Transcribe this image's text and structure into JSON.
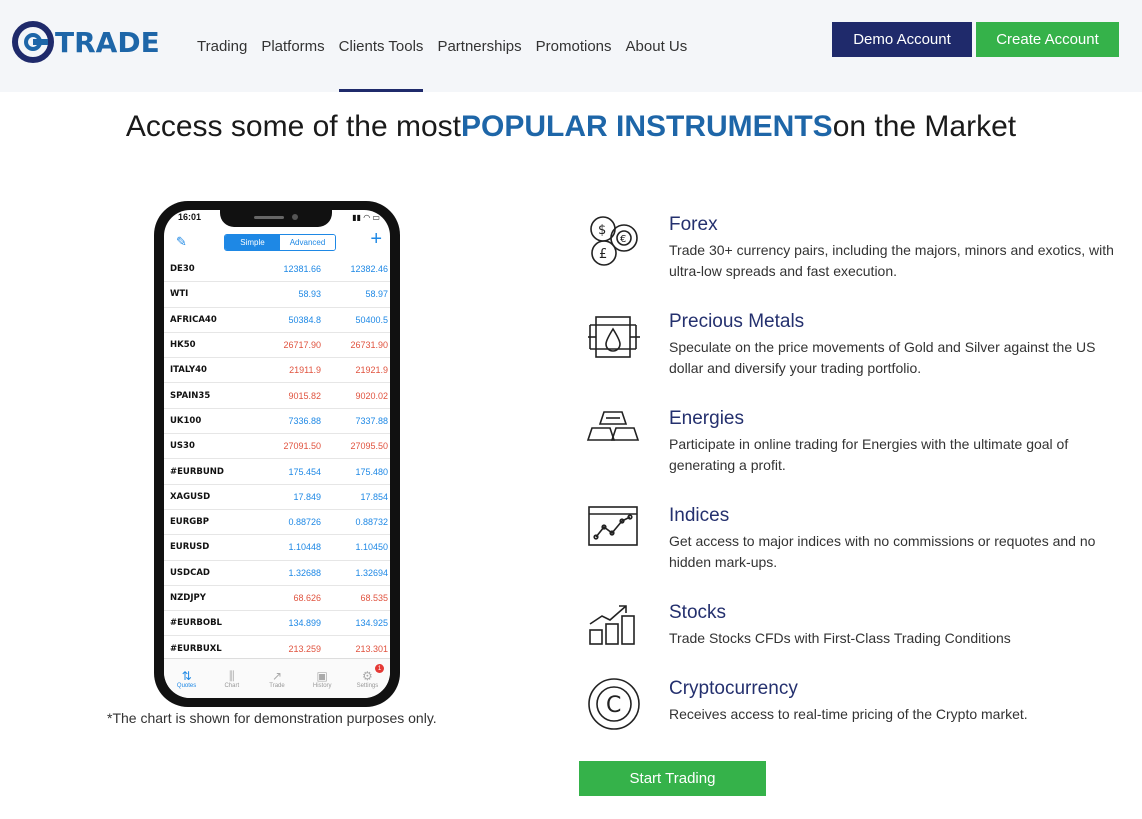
{
  "brand": {
    "name": "TRADE",
    "color": "#1e66a8"
  },
  "nav": {
    "items": [
      {
        "label": "Trading"
      },
      {
        "label": "Platforms"
      },
      {
        "label": "Clients Tools"
      },
      {
        "label": "Partnerships"
      },
      {
        "label": "Promotions"
      },
      {
        "label": "About Us"
      }
    ],
    "active": "Clients Tools"
  },
  "header_buttons": {
    "demo": "Demo Account",
    "create": "Create Account"
  },
  "headline": {
    "before": "Access some of the most",
    "highlight": "POPULAR INSTRUMENTS",
    "after": "on the Market"
  },
  "phone": {
    "time": "16:01",
    "segment": {
      "simple": "Simple",
      "advanced": "Advanced"
    },
    "quotes": [
      {
        "symbol": "DE30",
        "bid": "12381.66",
        "ask": "12382.46",
        "color": "blue"
      },
      {
        "symbol": "WTI",
        "bid": "58.93",
        "ask": "58.97",
        "color": "blue"
      },
      {
        "symbol": "AFRICA40",
        "bid": "50384.8",
        "ask": "50400.5",
        "color": "blue"
      },
      {
        "symbol": "HK50",
        "bid": "26717.90",
        "ask": "26731.90",
        "color": "red"
      },
      {
        "symbol": "ITALY40",
        "bid": "21911.9",
        "ask": "21921.9",
        "color": "red"
      },
      {
        "symbol": "SPAIN35",
        "bid": "9015.82",
        "ask": "9020.02",
        "color": "red"
      },
      {
        "symbol": "UK100",
        "bid": "7336.88",
        "ask": "7337.88",
        "color": "blue"
      },
      {
        "symbol": "US30",
        "bid": "27091.50",
        "ask": "27095.50",
        "color": "red"
      },
      {
        "symbol": "#EURBUND",
        "bid": "175.454",
        "ask": "175.480",
        "color": "blue"
      },
      {
        "symbol": "XAGUSD",
        "bid": "17.849",
        "ask": "17.854",
        "color": "blue"
      },
      {
        "symbol": "EURGBP",
        "bid": "0.88726",
        "ask": "0.88732",
        "color": "blue"
      },
      {
        "symbol": "EURUSD",
        "bid": "1.10448",
        "ask": "1.10450",
        "color": "blue"
      },
      {
        "symbol": "USDCAD",
        "bid": "1.32688",
        "ask": "1.32694",
        "color": "blue"
      },
      {
        "symbol": "NZDJPY",
        "bid": "68.626",
        "ask": "68.535",
        "color": "red"
      },
      {
        "symbol": "#EURBOBL",
        "bid": "134.899",
        "ask": "134.925",
        "color": "blue"
      },
      {
        "symbol": "#EURBUXL",
        "bid": "213.259",
        "ask": "213.301",
        "color": "red"
      }
    ],
    "tabs": [
      {
        "label": "Quotes",
        "icon": "quotes-icon"
      },
      {
        "label": "Chart",
        "icon": "chart-icon"
      },
      {
        "label": "Trade",
        "icon": "trade-icon"
      },
      {
        "label": "History",
        "icon": "history-icon"
      },
      {
        "label": "Settings",
        "icon": "settings-icon",
        "badge": "1"
      }
    ]
  },
  "disclaimer": "*The chart is shown for demonstration purposes only.",
  "instruments": [
    {
      "title": "Forex",
      "icon": "forex-icon",
      "description": "Trade 30+ currency pairs, including the majors, minors and exotics, with ultra-low spreads and fast execution."
    },
    {
      "title": "Precious Metals",
      "icon": "precious-metals-icon",
      "description": "Speculate on the price movements of Gold and Silver against the US dollar and diversify your trading portfolio."
    },
    {
      "title": "Energies",
      "icon": "energies-icon",
      "description": "Participate in online trading for Energies with the ultimate goal of generating a profit."
    },
    {
      "title": "Indices",
      "icon": "indices-icon",
      "description": "Get access to major indices with no commissions or requotes and no hidden mark-ups."
    },
    {
      "title": "Stocks",
      "icon": "stocks-icon",
      "description": "Trade Stocks CFDs with First-Class Trading Conditions"
    },
    {
      "title": "Cryptocurrency",
      "icon": "cryptocurrency-icon",
      "description": "Receives access to real-time pricing of the Crypto market."
    }
  ],
  "cta": "Start Trading",
  "colors": {
    "navy": "#1f2a6b",
    "green": "#35b24a",
    "blue": "#1e66a8",
    "quote_blue": "#1e88e5",
    "quote_red": "#e0533f"
  }
}
